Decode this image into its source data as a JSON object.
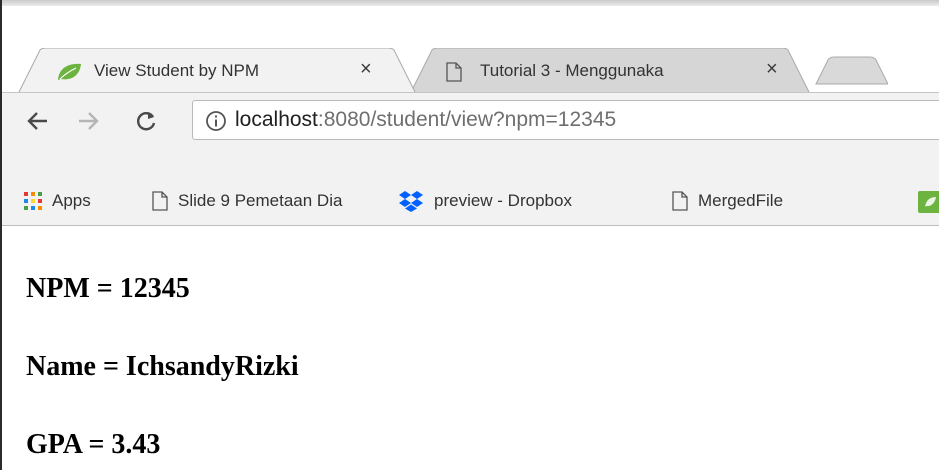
{
  "tabs": [
    {
      "label": "View Student by NPM",
      "close": "×",
      "active": true,
      "icon": "spring-leaf-icon"
    },
    {
      "label": "Tutorial 3 - Menggunaka",
      "close": "×",
      "active": false,
      "icon": "document-icon"
    }
  ],
  "toolbar": {
    "back_icon": "arrow-left-icon",
    "forward_icon": "arrow-right-icon",
    "reload_icon": "reload-icon",
    "info_icon": "info-circle-icon",
    "url_host": "localhost",
    "url_rest": ":8080/student/view?npm=12345"
  },
  "bookmarks": [
    {
      "label": "Apps",
      "icon": "apps-grid-icon"
    },
    {
      "label": "Slide 9 Pemetaan Dia",
      "icon": "document-icon"
    },
    {
      "label": "preview - Dropbox",
      "icon": "dropbox-icon"
    },
    {
      "label": "MergedFile",
      "icon": "document-icon"
    }
  ],
  "student": {
    "npm": "NPM = 12345",
    "name": "Name = IchsandyRizki",
    "gpa": "GPA = 3.43"
  },
  "colors": {
    "spring_green": "#6db33f",
    "dropbox_blue": "#0061fe",
    "toolbar_bg": "#f2f2f2",
    "inactive_tab": "#d6d6d6"
  }
}
